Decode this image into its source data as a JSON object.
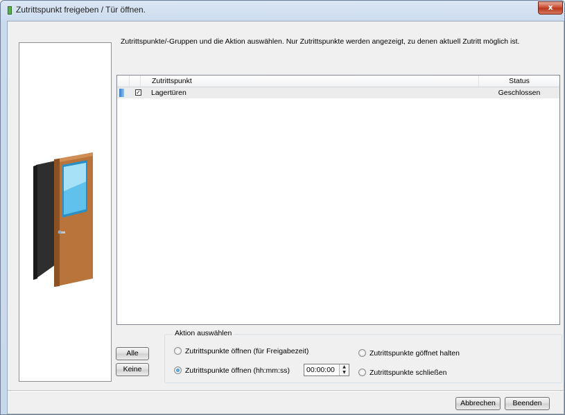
{
  "window": {
    "title": "Zutrittspunkt freigeben / Tür öffnen.",
    "close_label": "x"
  },
  "instruction": "Zutrittspunkte/-Gruppen und die Aktion auswählen. Nur Zutrittspunkte werden angezeigt, zu denen aktuell Zutritt möglich ist.",
  "list": {
    "columns": [
      "Zutrittspunkt",
      "Status"
    ],
    "rows": [
      {
        "name": "Lagertüren",
        "status": "Geschlossen",
        "checked": true
      }
    ]
  },
  "buttons": {
    "alle": "Alle",
    "keine": "Keine",
    "abbrechen": "Abbrechen",
    "beenden": "Beenden"
  },
  "action_group": {
    "legend": "Aktion auswählen",
    "options": [
      {
        "label": "Zutrittspunkte öffnen (für Freigabezeit)",
        "selected": false
      },
      {
        "label": "Zutrittspunkte öffnen (hh:mm:ss)",
        "selected": true
      },
      {
        "label": "Zutrittspunkte göffnet halten",
        "selected": false
      },
      {
        "label": "Zutrittspunkte schließen",
        "selected": false
      }
    ],
    "time_value": "00:00:00"
  },
  "colors": {
    "door_frame": "#3a3a3a",
    "door_panel": "#b9743b",
    "door_glass": "#4fb6e6"
  }
}
